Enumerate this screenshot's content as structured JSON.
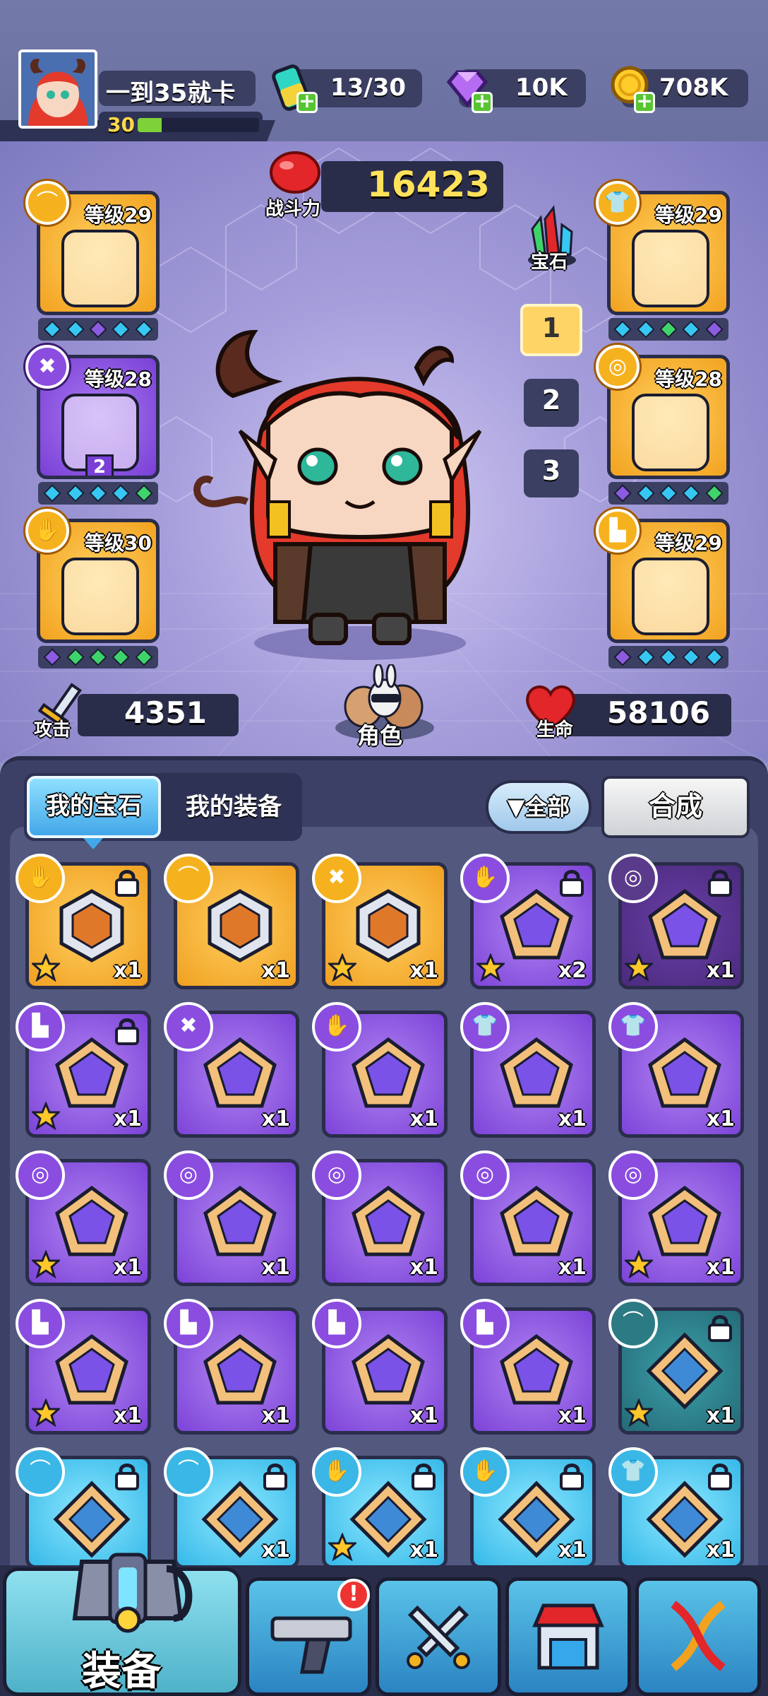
{
  "player": {
    "name": "一到35就卡",
    "level": "30",
    "xp_fraction": 0.2
  },
  "resources": [
    {
      "icon": "energy-battery-icon",
      "value": "13/30"
    },
    {
      "icon": "purple-diamond-icon",
      "value": "10K"
    },
    {
      "icon": "gold-coin-icon",
      "value": "708K"
    }
  ],
  "power": {
    "label": "战斗力",
    "value": "16423"
  },
  "gem_button": {
    "label": "宝石"
  },
  "loadout_tabs": [
    "1",
    "2",
    "3"
  ],
  "active_loadout": "1",
  "left_slots": [
    {
      "type": "hat-icon",
      "level": "等级29",
      "rarity": "orange",
      "gem_colors": [
        "#36c7f2",
        "#36c7f2",
        "#8b5be0",
        "#36c7f2",
        "#36c7f2"
      ]
    },
    {
      "type": "necklace-icon",
      "level": "等级28",
      "rarity": "purple",
      "badge": "2",
      "gem_colors": [
        "#36c7f2",
        "#36c7f2",
        "#36c7f2",
        "#36c7f2",
        "#3fd46b"
      ]
    },
    {
      "type": "glove-icon",
      "level": "等级30",
      "rarity": "orange",
      "gem_colors": [
        "#8b5be0",
        "#3fd46b",
        "#3fd46b",
        "#3fd46b",
        "#3fd46b"
      ]
    }
  ],
  "right_slots": [
    {
      "type": "shirt-icon",
      "level": "等级29",
      "rarity": "orange",
      "gem_colors": [
        "#36c7f2",
        "#36c7f2",
        "#3fd46b",
        "#36c7f2",
        "#8b5be0"
      ]
    },
    {
      "type": "belt-icon",
      "level": "等级28",
      "rarity": "orange",
      "gem_colors": [
        "#8b5be0",
        "#36c7f2",
        "#36c7f2",
        "#36c7f2",
        "#3fd46b"
      ]
    },
    {
      "type": "boot-icon",
      "level": "等级29",
      "rarity": "orange",
      "gem_colors": [
        "#8b5be0",
        "#36c7f2",
        "#36c7f2",
        "#36c7f2",
        "#36c7f2"
      ]
    }
  ],
  "stats": {
    "attack_label": "攻击",
    "attack": "4351",
    "hp_label": "生命",
    "hp": "58106",
    "character_label": "角色"
  },
  "panel": {
    "tab_gems": "我的宝石",
    "tab_equipment": "我的装备",
    "filter": "全部",
    "synthesize": "合成"
  },
  "gems": [
    {
      "type": "glove-icon",
      "rarity": "orange",
      "locked": true,
      "star": true,
      "count": "x1",
      "shape": "hex"
    },
    {
      "type": "hat-icon",
      "rarity": "orange",
      "locked": false,
      "star": false,
      "count": "x1",
      "shape": "hex"
    },
    {
      "type": "necklace-icon",
      "rarity": "orange",
      "locked": false,
      "star": true,
      "count": "x1",
      "shape": "hex"
    },
    {
      "type": "glove-icon",
      "rarity": "purple",
      "locked": true,
      "star": true,
      "count": "x2",
      "shape": "pent"
    },
    {
      "type": "belt-icon",
      "rarity": "darkpurple",
      "locked": true,
      "star": true,
      "count": "x1",
      "shape": "pent"
    },
    {
      "type": "boot-icon",
      "rarity": "purple",
      "locked": true,
      "star": true,
      "count": "x1",
      "shape": "pent"
    },
    {
      "type": "necklace-icon",
      "rarity": "purple",
      "locked": false,
      "star": false,
      "count": "x1",
      "shape": "pent"
    },
    {
      "type": "glove-icon",
      "rarity": "purple",
      "locked": false,
      "star": false,
      "count": "x1",
      "shape": "pent"
    },
    {
      "type": "shirt-icon",
      "rarity": "purple",
      "locked": false,
      "star": false,
      "count": "x1",
      "shape": "pent"
    },
    {
      "type": "shirt-icon",
      "rarity": "purple",
      "locked": false,
      "star": false,
      "count": "x1",
      "shape": "pent"
    },
    {
      "type": "belt-icon",
      "rarity": "purple",
      "locked": false,
      "star": true,
      "count": "x1",
      "shape": "pent"
    },
    {
      "type": "belt-icon",
      "rarity": "purple",
      "locked": false,
      "star": false,
      "count": "x1",
      "shape": "pent"
    },
    {
      "type": "belt-icon",
      "rarity": "purple",
      "locked": false,
      "star": false,
      "count": "x1",
      "shape": "pent"
    },
    {
      "type": "belt-icon",
      "rarity": "purple",
      "locked": false,
      "star": false,
      "count": "x1",
      "shape": "pent"
    },
    {
      "type": "belt-icon",
      "rarity": "purple",
      "locked": false,
      "star": true,
      "count": "x1",
      "shape": "pent"
    },
    {
      "type": "boot-icon",
      "rarity": "purple",
      "locked": false,
      "star": true,
      "count": "x1",
      "shape": "pent"
    },
    {
      "type": "boot-icon",
      "rarity": "purple",
      "locked": false,
      "star": false,
      "count": "x1",
      "shape": "pent"
    },
    {
      "type": "boot-icon",
      "rarity": "purple",
      "locked": false,
      "star": false,
      "count": "x1",
      "shape": "pent"
    },
    {
      "type": "boot-icon",
      "rarity": "purple",
      "locked": false,
      "star": false,
      "count": "x1",
      "shape": "pent"
    },
    {
      "type": "hat-icon",
      "rarity": "teal",
      "locked": true,
      "star": true,
      "count": "x1",
      "shape": "diamond"
    },
    {
      "type": "hat-icon",
      "rarity": "cyan",
      "locked": true,
      "star": false,
      "count": "",
      "shape": "diamond"
    },
    {
      "type": "hat-icon",
      "rarity": "cyan",
      "locked": true,
      "star": false,
      "count": "x1",
      "shape": "diamond"
    },
    {
      "type": "glove-icon",
      "rarity": "cyan",
      "locked": true,
      "star": true,
      "count": "x1",
      "shape": "diamond"
    },
    {
      "type": "glove-icon",
      "rarity": "cyan",
      "locked": true,
      "star": false,
      "count": "x1",
      "shape": "diamond"
    },
    {
      "type": "shirt-icon",
      "rarity": "cyan",
      "locked": true,
      "star": false,
      "count": "x1",
      "shape": "diamond"
    }
  ],
  "bottom_nav": [
    {
      "name": "nav-equipment",
      "label": "装备",
      "icon": "armor-icon",
      "active": true
    },
    {
      "name": "nav-weapons",
      "label": "",
      "icon": "pistol-icon",
      "badge": "!"
    },
    {
      "name": "nav-battle",
      "label": "",
      "icon": "crossed-swords-icon"
    },
    {
      "name": "nav-shop",
      "label": "",
      "icon": "shop-icon"
    },
    {
      "name": "nav-evolve",
      "label": "",
      "icon": "dna-icon"
    }
  ]
}
